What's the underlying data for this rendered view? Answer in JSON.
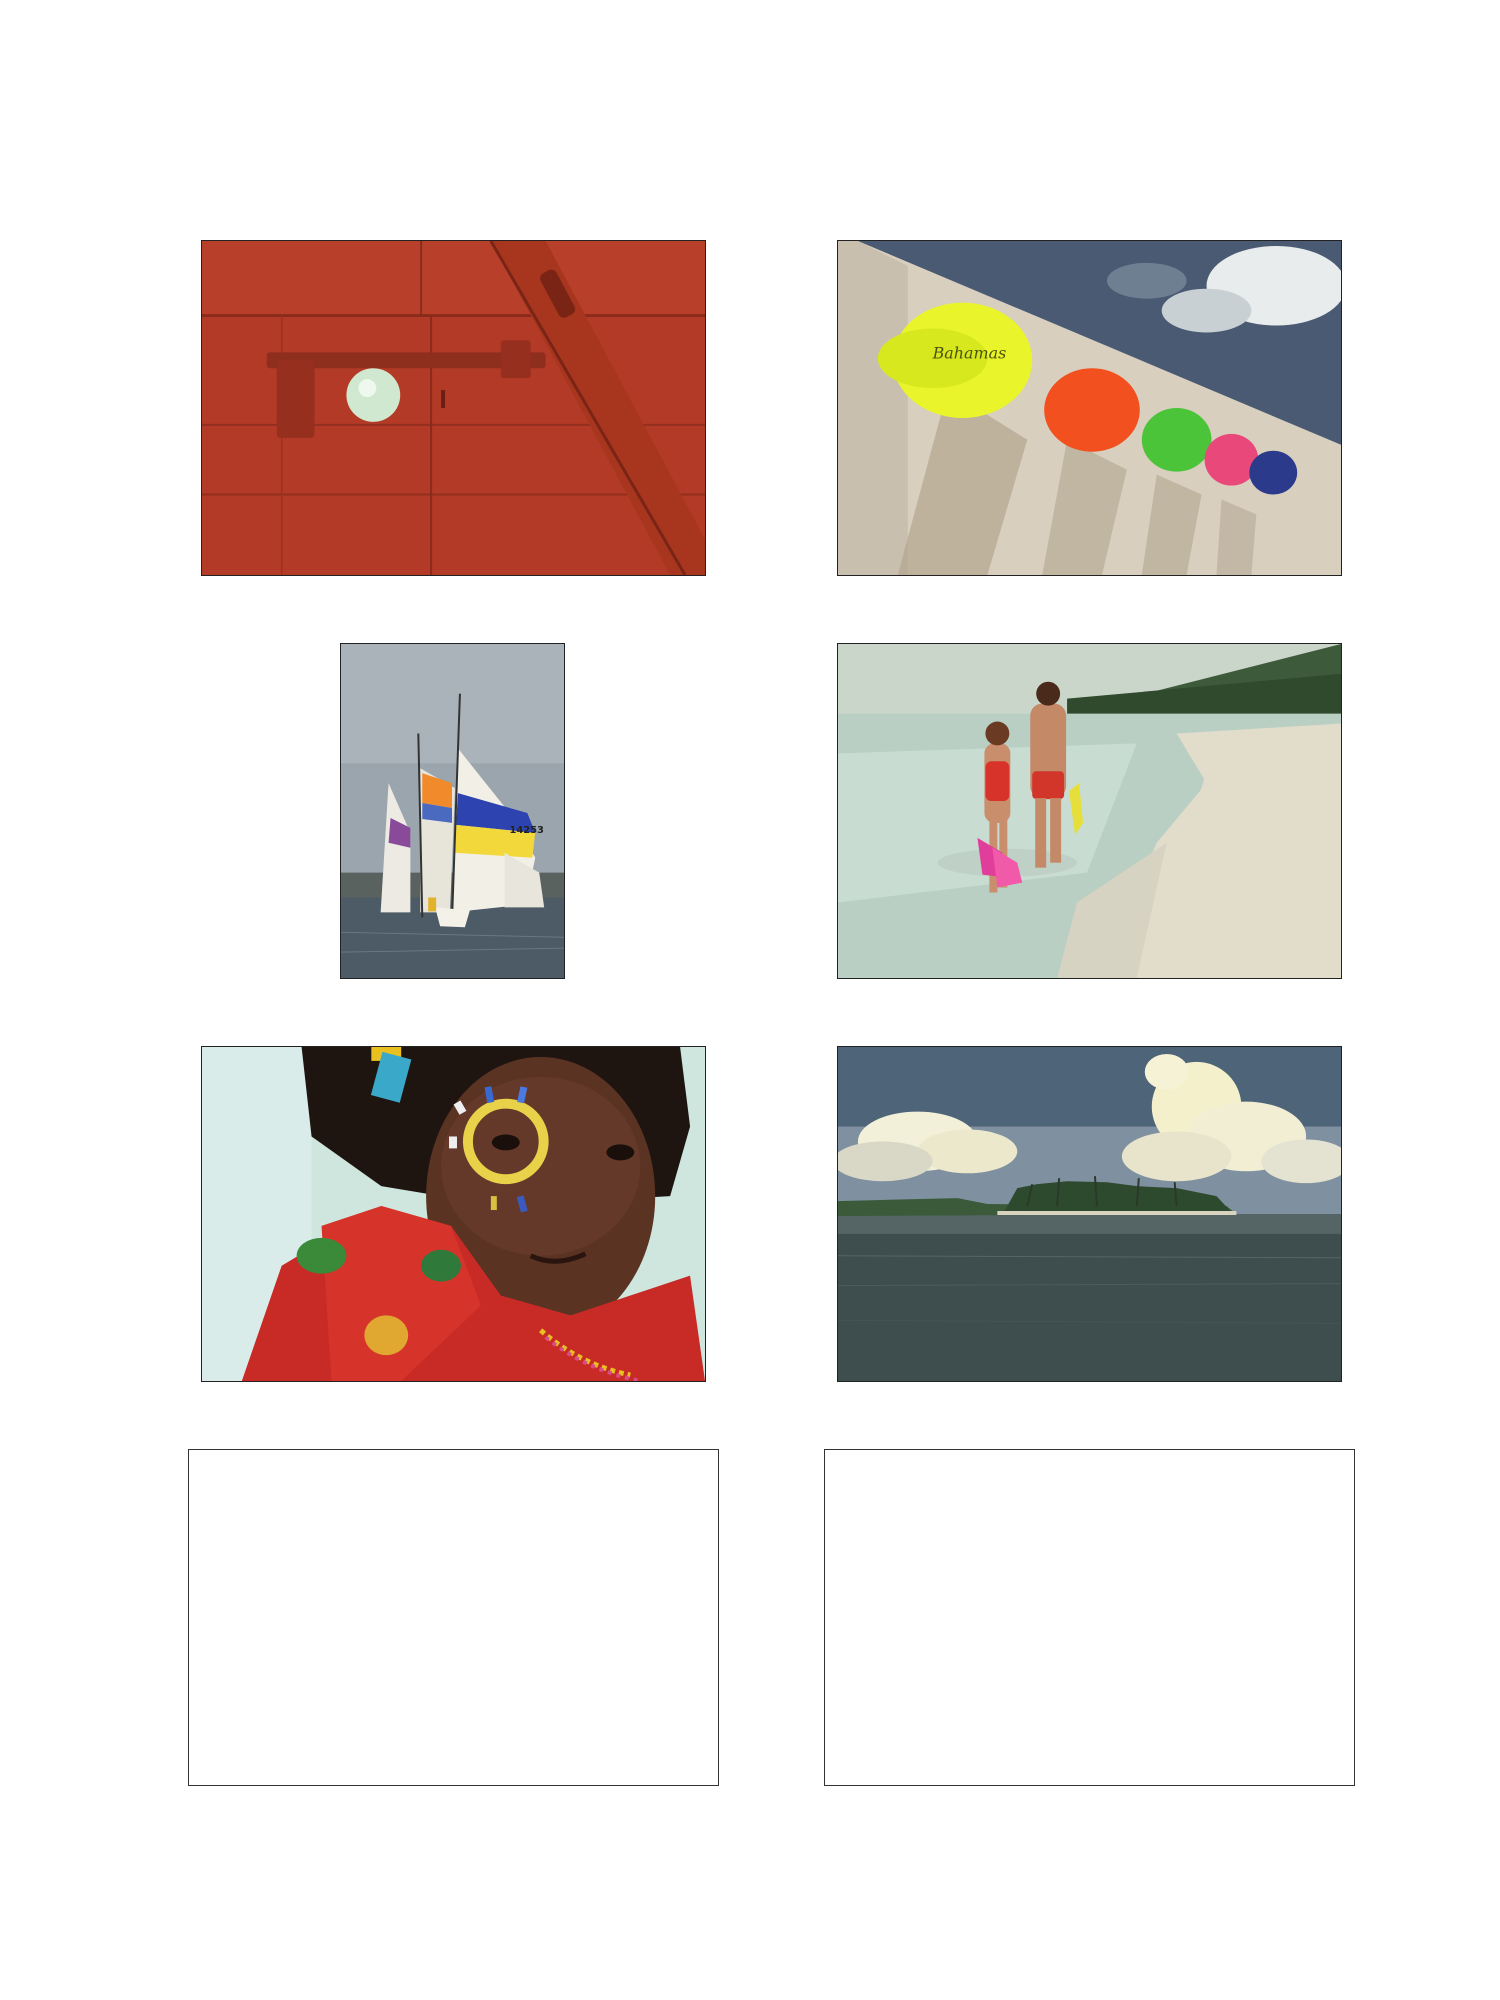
{
  "photos": [
    {
      "subject": "red-door-latch"
    },
    {
      "subject": "neon-caps-on-wall",
      "cap_text": "Bahamas"
    },
    {
      "subject": "regatta-sailboats",
      "sail_number": "14253"
    },
    {
      "subject": "couple-walking-beach"
    },
    {
      "subject": "girl-face-paint"
    },
    {
      "subject": "palm-island-seascape"
    }
  ],
  "empty_frames": 2,
  "colors": {
    "door_red": "#b33a26",
    "cap_yellow": "#e9f52a",
    "cap_orange": "#f2501f",
    "cap_green": "#4bc43a",
    "cap_pink": "#e8487a",
    "cap_navy": "#2b3a8a"
  }
}
